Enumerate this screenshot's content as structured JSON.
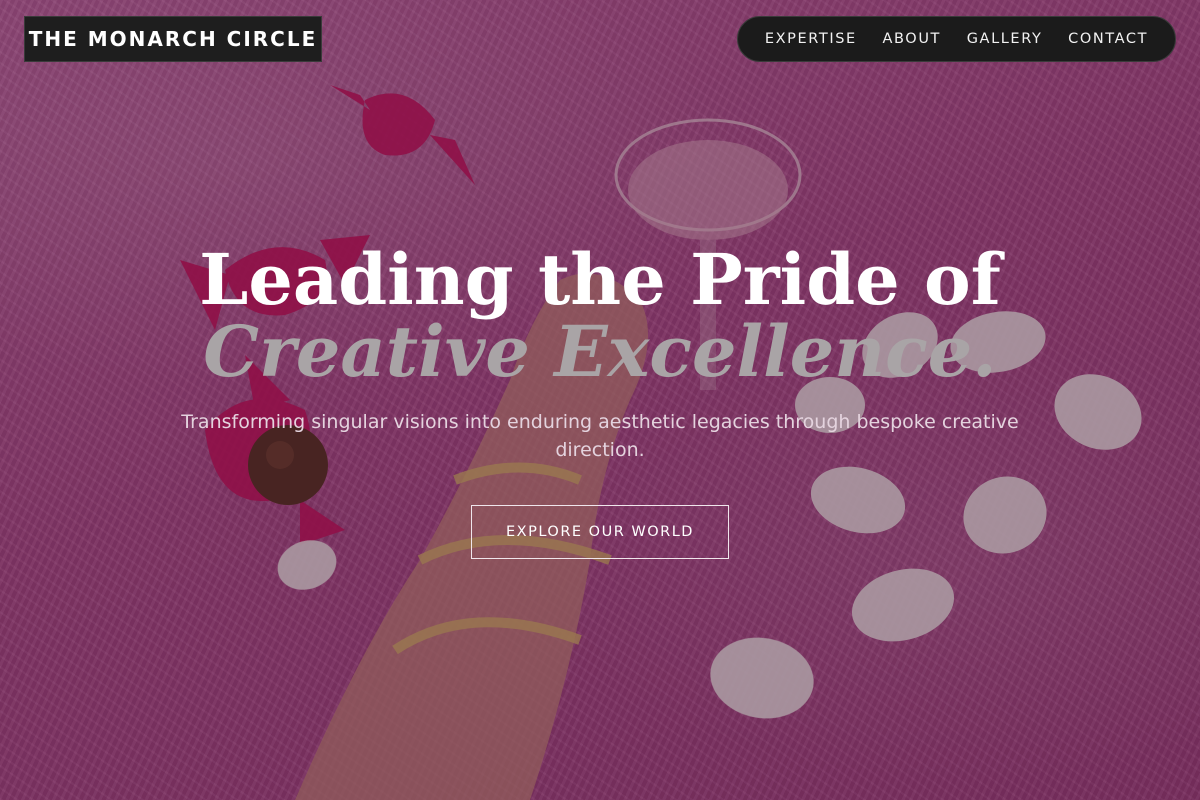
{
  "brand": {
    "name": "THE MONARCH CIRCLE"
  },
  "nav": {
    "items": [
      {
        "label": "EXPERTISE"
      },
      {
        "label": "ABOUT"
      },
      {
        "label": "GALLERY"
      },
      {
        "label": "CONTACT"
      }
    ]
  },
  "hero": {
    "title_line1": "Leading the Pride of",
    "title_line2": "Creative Excellence.",
    "subtitle": "Transforming singular visions into enduring aesthetic legacies through bespoke creative direction.",
    "cta_label": "EXPLORE OUR WORLD"
  },
  "colors": {
    "accent_pink": "#b44f90",
    "header_dark": "#1e1e1e",
    "title_white": "#ffffff",
    "title_gray": "#a9a4a6"
  }
}
